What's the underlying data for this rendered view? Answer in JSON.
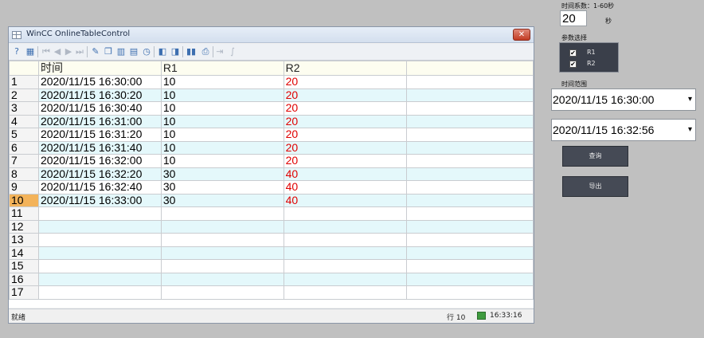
{
  "window": {
    "title": "WinCC OnlineTableControl",
    "close_glyph": "✕"
  },
  "toolbar": {
    "icons": [
      {
        "name": "help-icon",
        "glyph": "?"
      },
      {
        "name": "config-dialog-icon",
        "glyph": "▦"
      },
      {
        "name": "first-record-icon",
        "glyph": "⏮"
      },
      {
        "name": "previous-record-icon",
        "glyph": "◀"
      },
      {
        "name": "next-record-icon",
        "glyph": "▶"
      },
      {
        "name": "last-record-icon",
        "glyph": "⏭"
      },
      {
        "name": "edit-icon",
        "glyph": "✎"
      },
      {
        "name": "copy-icon",
        "glyph": "❐"
      },
      {
        "name": "select-columns-icon",
        "glyph": "▥"
      },
      {
        "name": "select-archive-icon",
        "glyph": "▤"
      },
      {
        "name": "time-range-icon",
        "glyph": "◷"
      },
      {
        "name": "previous-column-icon",
        "glyph": "◧"
      },
      {
        "name": "next-column-icon",
        "glyph": "◨"
      },
      {
        "name": "stop-icon",
        "glyph": "▮▮"
      },
      {
        "name": "print-icon",
        "glyph": "⎙"
      },
      {
        "name": "export-icon",
        "glyph": "⇥"
      },
      {
        "name": "statistics-icon",
        "glyph": "∫"
      }
    ]
  },
  "grid": {
    "headers": [
      "",
      "时间",
      "R1",
      "R2",
      ""
    ],
    "rows": [
      {
        "n": "1",
        "time": "2020/11/15 16:30:00",
        "r1": "10",
        "r2": "20"
      },
      {
        "n": "2",
        "time": "2020/11/15 16:30:20",
        "r1": "10",
        "r2": "20"
      },
      {
        "n": "3",
        "time": "2020/11/15 16:30:40",
        "r1": "10",
        "r2": "20"
      },
      {
        "n": "4",
        "time": "2020/11/15 16:31:00",
        "r1": "10",
        "r2": "20"
      },
      {
        "n": "5",
        "time": "2020/11/15 16:31:20",
        "r1": "10",
        "r2": "20"
      },
      {
        "n": "6",
        "time": "2020/11/15 16:31:40",
        "r1": "10",
        "r2": "20"
      },
      {
        "n": "7",
        "time": "2020/11/15 16:32:00",
        "r1": "10",
        "r2": "20"
      },
      {
        "n": "8",
        "time": "2020/11/15 16:32:20",
        "r1": "30",
        "r2": "40"
      },
      {
        "n": "9",
        "time": "2020/11/15 16:32:40",
        "r1": "30",
        "r2": "40"
      },
      {
        "n": "10",
        "time": "2020/11/15 16:33:00",
        "r1": "30",
        "r2": "40"
      },
      {
        "n": "11",
        "time": "",
        "r1": "",
        "r2": ""
      },
      {
        "n": "12",
        "time": "",
        "r1": "",
        "r2": ""
      },
      {
        "n": "13",
        "time": "",
        "r1": "",
        "r2": ""
      },
      {
        "n": "14",
        "time": "",
        "r1": "",
        "r2": ""
      },
      {
        "n": "15",
        "time": "",
        "r1": "",
        "r2": ""
      },
      {
        "n": "16",
        "time": "",
        "r1": "",
        "r2": ""
      },
      {
        "n": "17",
        "time": "",
        "r1": "",
        "r2": ""
      }
    ],
    "current_row": "10"
  },
  "statusbar": {
    "ready": "就绪",
    "row_info": "行 10",
    "time": "16:33:16"
  },
  "panel": {
    "time_factor_label": "时间系数：1-60秒",
    "time_factor_value": "20",
    "seconds_unit": "秒",
    "param_label": "参数选择",
    "params": [
      {
        "label": "R1",
        "checked": "✔"
      },
      {
        "label": "R2",
        "checked": "✔"
      }
    ],
    "time_range_label": "时间范围",
    "start_time": "2020/11/15 16:30:00",
    "end_time": "2020/11/15 16:32:56",
    "query_button": "查询",
    "export_button": "导出"
  },
  "colors": {
    "r2_value": "#e00000",
    "alt_row": "#e4f8fb",
    "current_row_marker": "#f3b35a"
  }
}
